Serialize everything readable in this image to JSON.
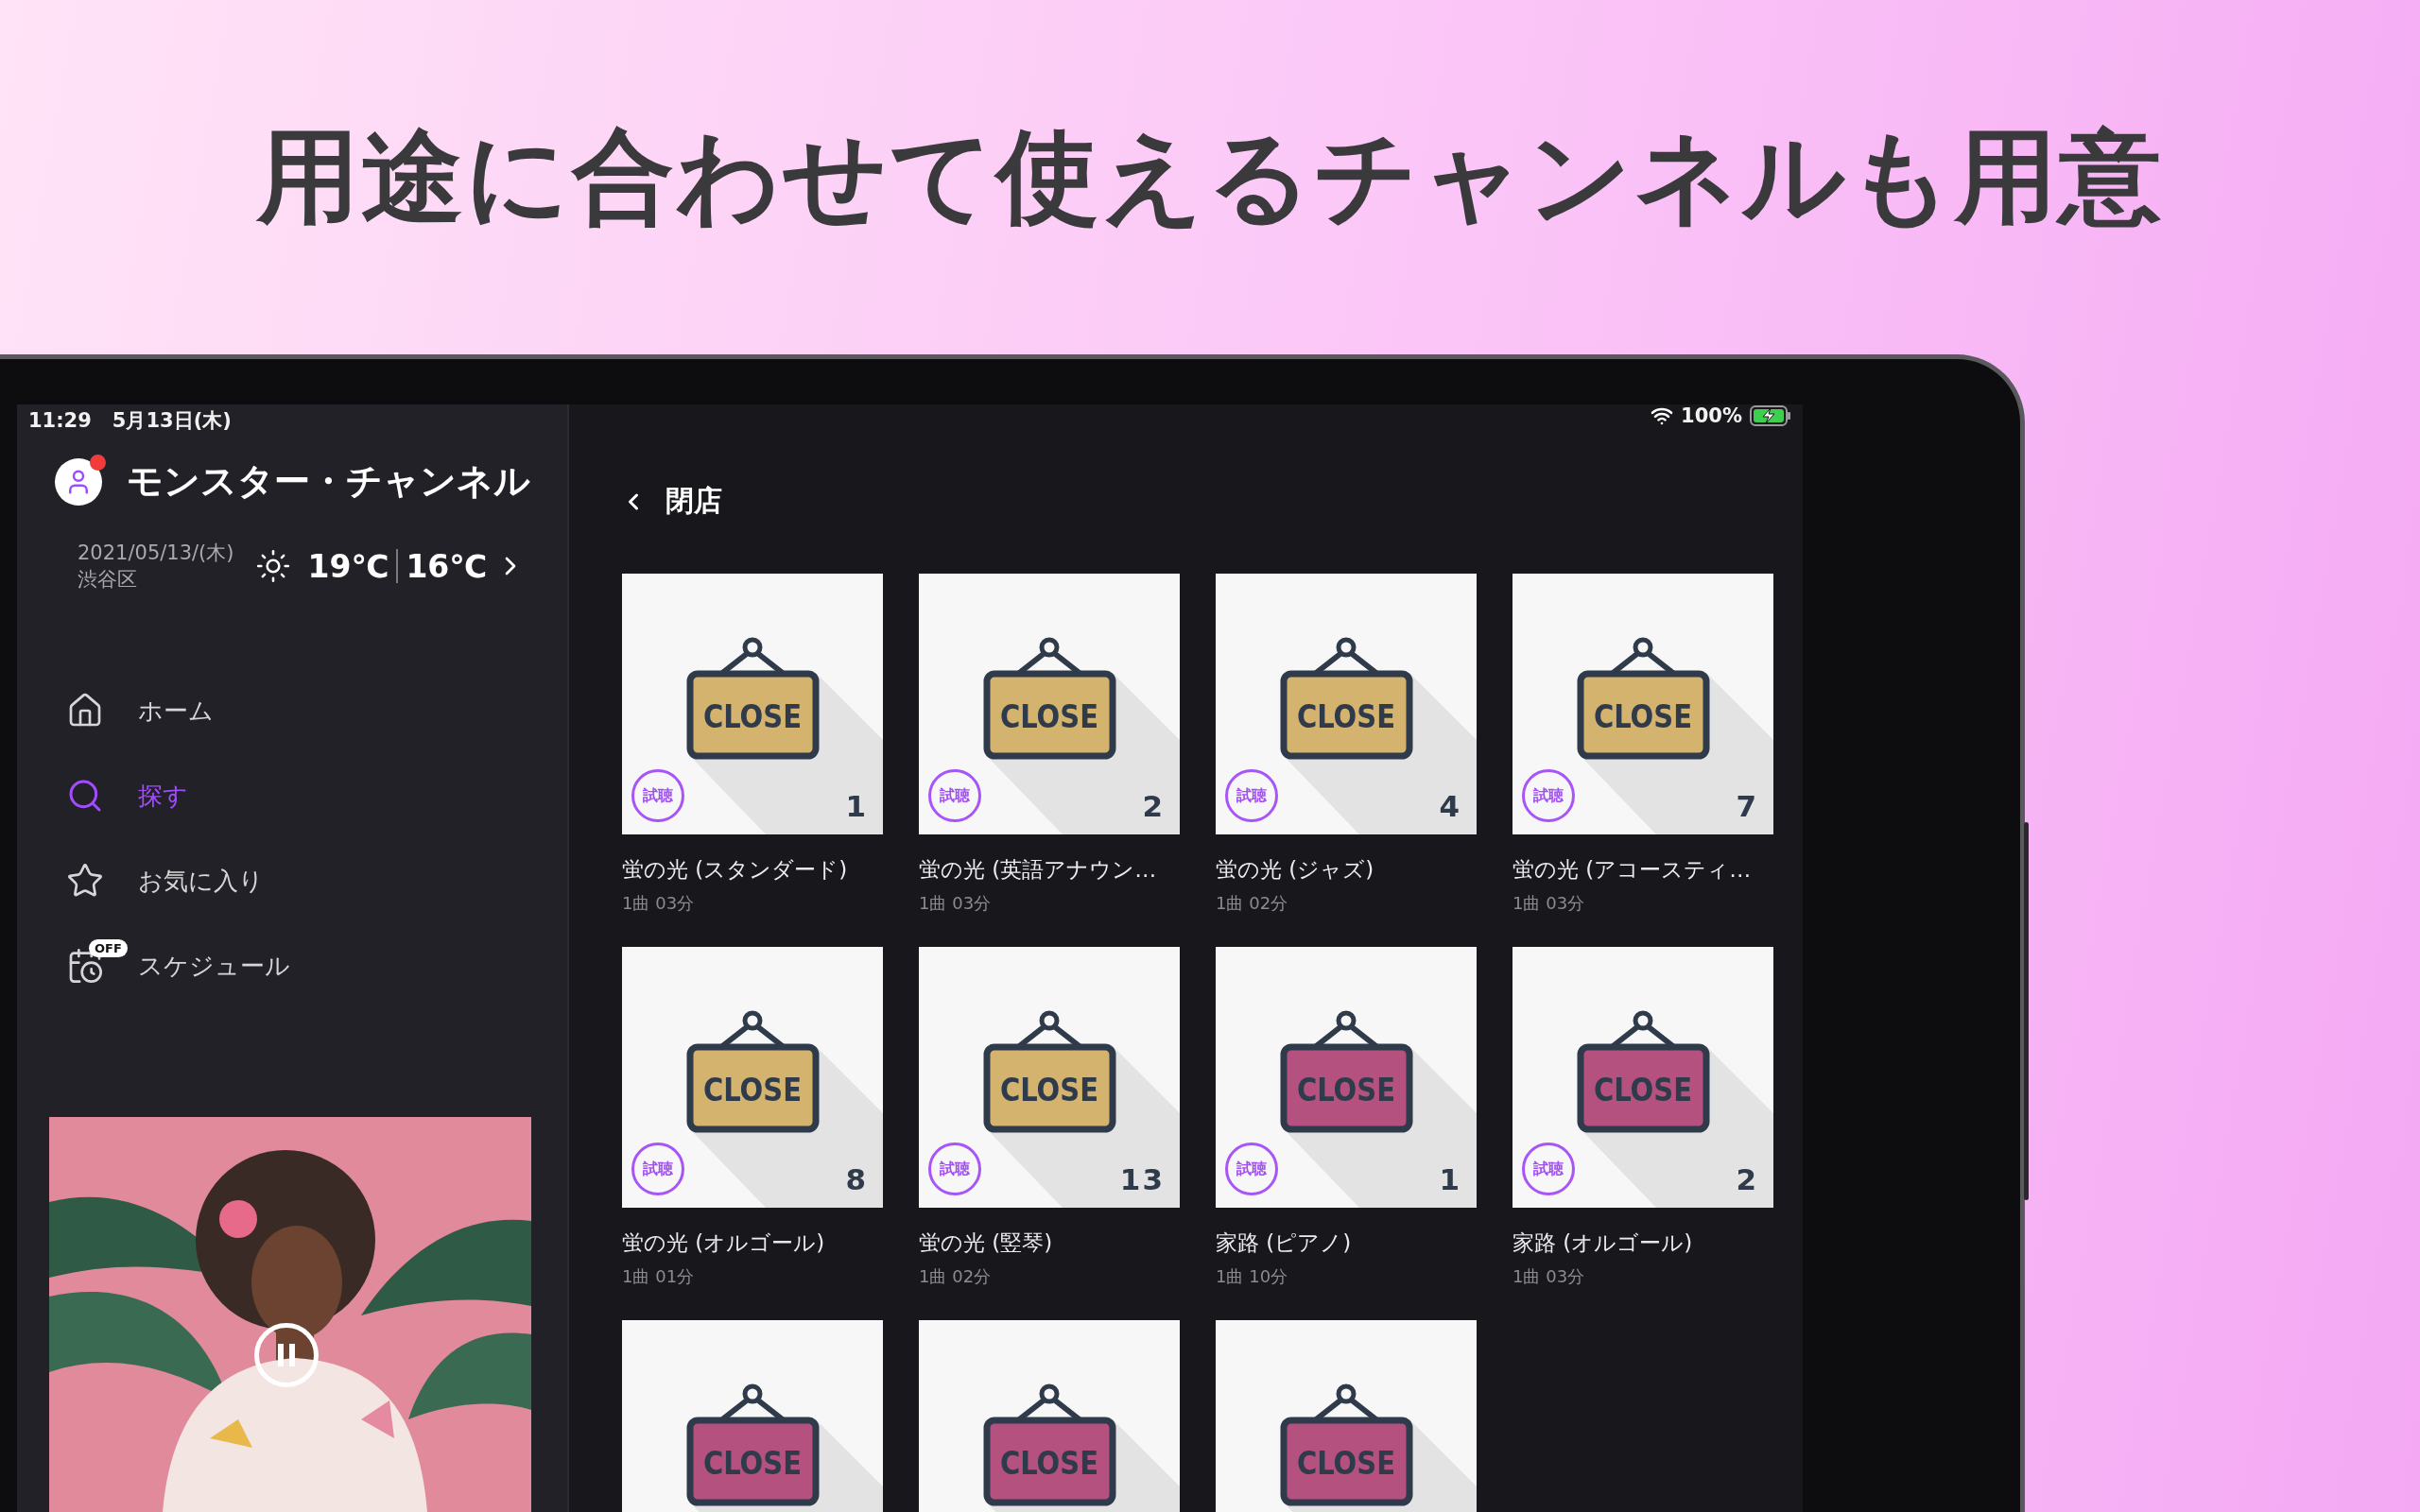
{
  "headline": "用途に合わせて使えるチャンネルも用意",
  "status_bar": {
    "time": "11:29",
    "date": "5月13日(木)",
    "battery": "100%",
    "charging": true
  },
  "sidebar": {
    "title": "モンスター・チャンネル",
    "notification": true,
    "date": "2021/05/13/(木)",
    "area": "渋谷区",
    "temp_high": "19℃",
    "temp_low": "16℃",
    "nav": [
      {
        "kind": "home",
        "label": "ホーム",
        "selected": false
      },
      {
        "kind": "search",
        "label": "探す",
        "selected": true
      },
      {
        "kind": "favorite",
        "label": "お気に入り",
        "selected": false
      },
      {
        "kind": "schedule",
        "label": "スケジュール",
        "selected": false,
        "badge": "OFF"
      }
    ],
    "now_playing": {
      "kind": "picture",
      "playing": true
    }
  },
  "main": {
    "title": "閉店",
    "cards": [
      {
        "sign": "CLOSE",
        "color": "#d4b36e",
        "badge": "試聴",
        "count": "1",
        "title": "蛍の光 (スタンダード)",
        "meta": "1曲 03分"
      },
      {
        "sign": "CLOSE",
        "color": "#d4b36e",
        "badge": "試聴",
        "count": "2",
        "title": "蛍の光 (英語アナウン…",
        "meta": "1曲 03分"
      },
      {
        "sign": "CLOSE",
        "color": "#d4b36e",
        "badge": "試聴",
        "count": "4",
        "title": "蛍の光 (ジャズ)",
        "meta": "1曲 02分"
      },
      {
        "sign": "CLOSE",
        "color": "#d4b36e",
        "badge": "試聴",
        "count": "7",
        "title": "蛍の光 (アコースティ…",
        "meta": "1曲 03分"
      },
      {
        "sign": "CLOSE",
        "color": "#d4b36e",
        "badge": "試聴",
        "count": "8",
        "title": "蛍の光 (オルゴール)",
        "meta": "1曲 01分"
      },
      {
        "sign": "CLOSE",
        "color": "#d4b36e",
        "badge": "試聴",
        "count": "13",
        "title": "蛍の光 (竪琴)",
        "meta": "1曲 02分"
      },
      {
        "sign": "CLOSE",
        "color": "#b5517f",
        "badge": "試聴",
        "count": "1",
        "title": "家路 (ピアノ)",
        "meta": "1曲 10分"
      },
      {
        "sign": "CLOSE",
        "color": "#b5517f",
        "badge": "試聴",
        "count": "2",
        "title": "家路 (オルゴール)",
        "meta": "1曲 03分"
      },
      {
        "sign": "CLOSE",
        "color": "#b5517f"
      },
      {
        "sign": "CLOSE",
        "color": "#b5517f"
      },
      {
        "sign": "CLOSE",
        "color": "#b5517f"
      }
    ]
  }
}
